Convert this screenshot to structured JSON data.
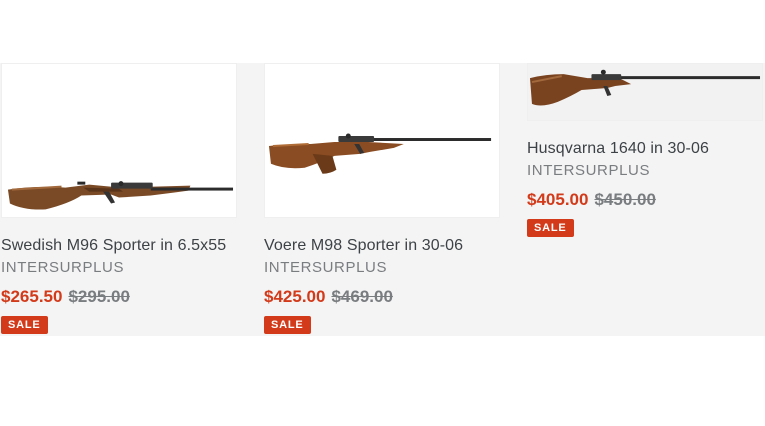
{
  "products": [
    {
      "title": "Swedish M96 Sporter in 6.5x55",
      "vendor": "INTERSURPLUS",
      "sale_price": "$265.50",
      "regular_price": "$295.00",
      "badge": "SALE",
      "image_icon": "rifle-image"
    },
    {
      "title": "Voere M98 Sporter in 30-06",
      "vendor": "INTERSURPLUS",
      "sale_price": "$425.00",
      "regular_price": "$469.00",
      "badge": "SALE",
      "image_icon": "rifle-image"
    },
    {
      "title": "Husqvarna 1640 in 30-06",
      "vendor": "INTERSURPLUS",
      "sale_price": "$405.00",
      "regular_price": "$450.00",
      "badge": "SALE",
      "image_icon": "rifle-image"
    }
  ],
  "colors": {
    "accent_sale": "#d23a1a",
    "title_text": "#3d4246",
    "muted_text": "#7a7d80",
    "background_strip": "#f4f4f4"
  }
}
